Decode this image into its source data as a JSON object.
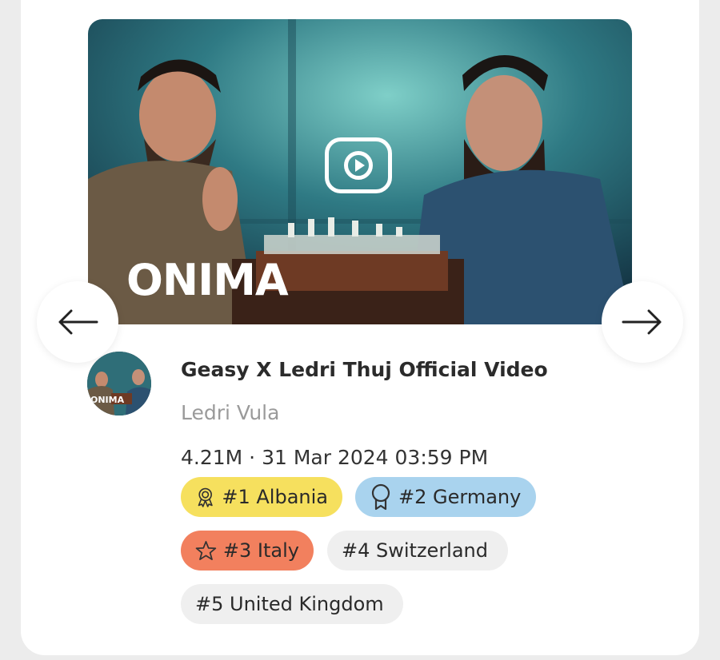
{
  "video": {
    "overlay_text": "ONIMA",
    "title": "Geasy X Ledri Thuj Official Video",
    "channel": "Ledri Vula",
    "meta": "4.21M · 31 Mar 2024 03:59 PM"
  },
  "rankings": [
    {
      "label": "#1 Albania",
      "icon": "medal-icon",
      "color": "#f6e05e"
    },
    {
      "label": "#2 Germany",
      "icon": "award-ribbon-icon",
      "color": "#a9d3ee"
    },
    {
      "label": "#3 Italy",
      "icon": "star-icon",
      "color": "#f2805e"
    },
    {
      "label": "#4 Switzerland",
      "icon": "",
      "color": "#efefef"
    },
    {
      "label": "#5 United Kingdom",
      "icon": "",
      "color": "#efefef"
    }
  ],
  "navigation": {
    "prev_icon": "arrow-left-icon",
    "next_icon": "arrow-right-icon"
  }
}
